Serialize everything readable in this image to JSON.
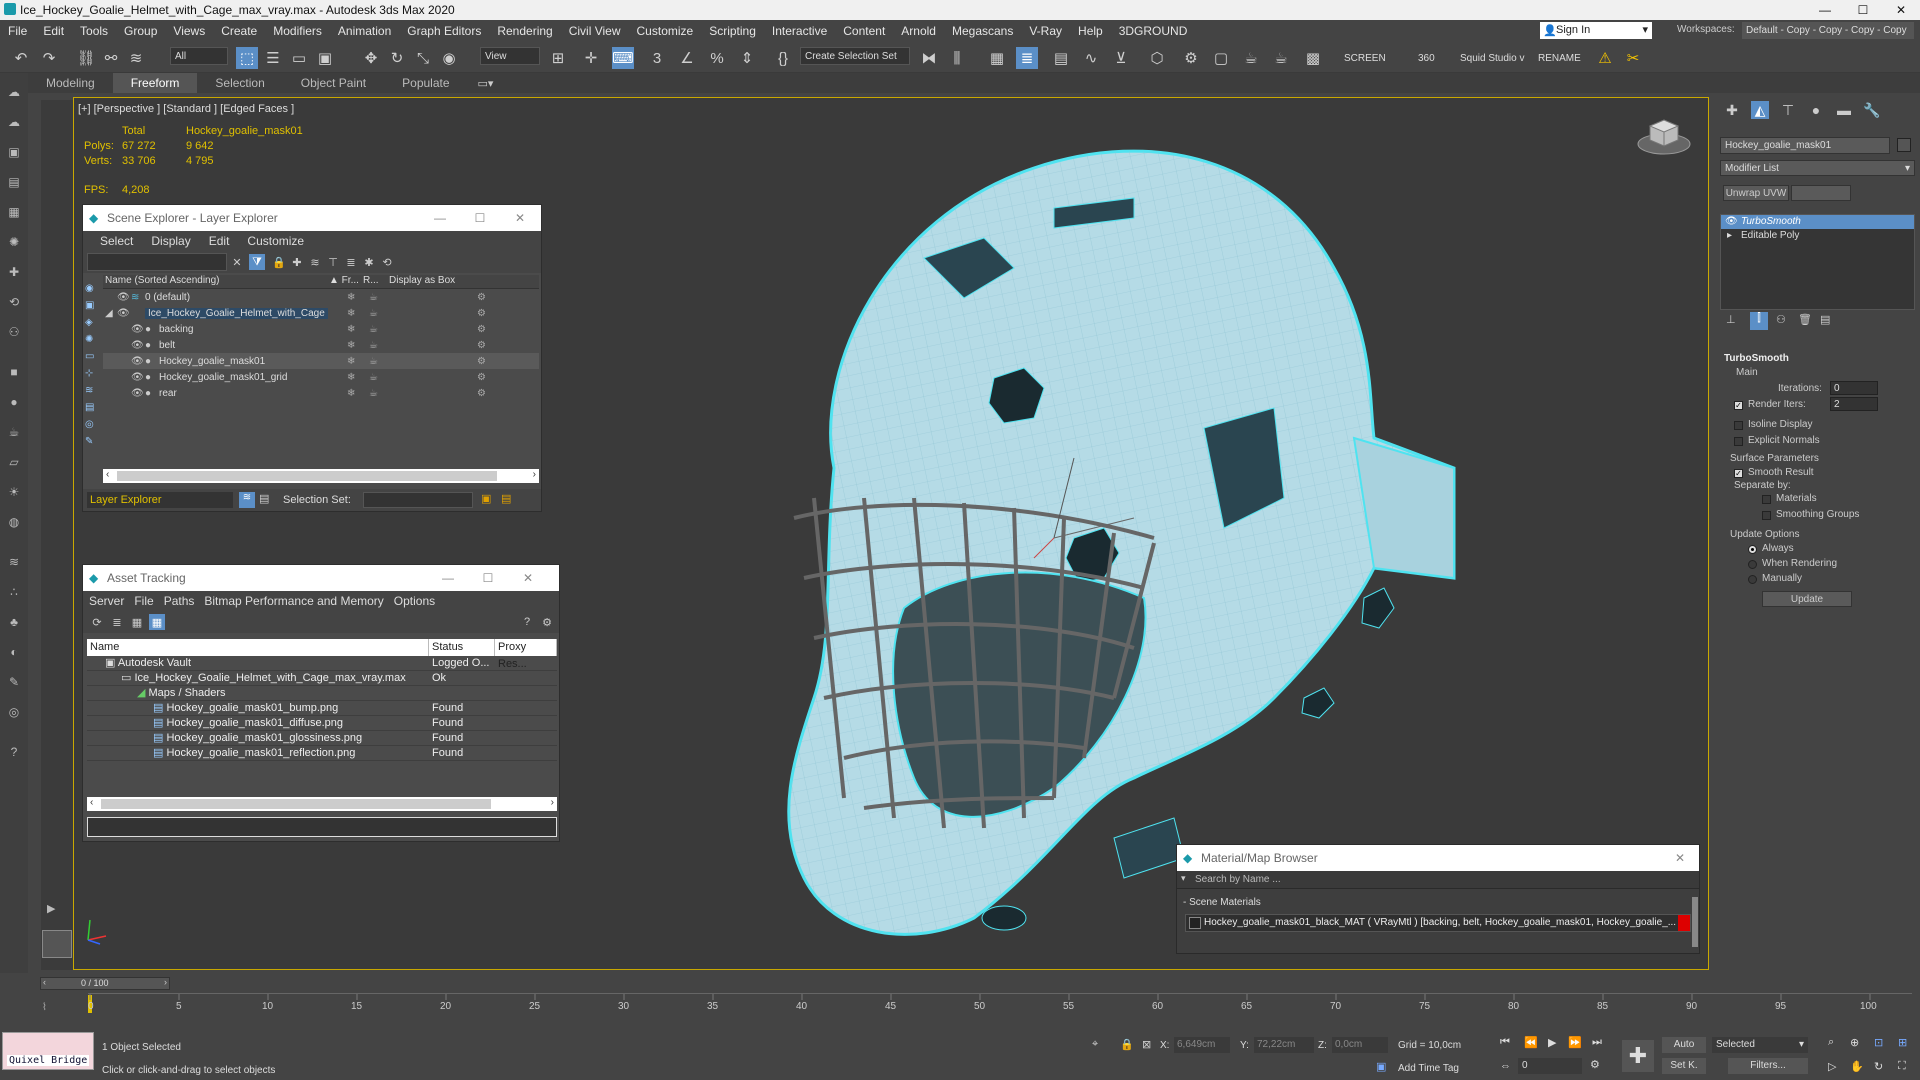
{
  "app": {
    "title": "Ice_Hockey_Goalie_Helmet_with_Cage_max_vray.max - Autodesk 3ds Max 2020",
    "window_buttons": [
      "—",
      "☐",
      "✕"
    ]
  },
  "menu": {
    "items": [
      "File",
      "Edit",
      "Tools",
      "Group",
      "Views",
      "Create",
      "Modifiers",
      "Animation",
      "Graph Editors",
      "Rendering",
      "Civil View",
      "Customize",
      "Scripting",
      "Interactive",
      "Content",
      "Arnold",
      "Megascans",
      "V-Ray",
      "Help",
      "3DGROUND"
    ],
    "sign_in": "Sign In",
    "workspaces_label": "Workspaces:",
    "workspace_value": "Default - Copy - Copy - Copy - Copy"
  },
  "toolbar": {
    "filter_value": "All",
    "refcoord_value": "View",
    "selection_set_value": "Create Selection Set",
    "screen_label": "SCREEN",
    "screen_value": "360",
    "squid_label": "Squid Studio v",
    "rename_label": "RENAME"
  },
  "ribbon": {
    "tabs": [
      "Modeling",
      "Freeform",
      "Selection",
      "Object Paint",
      "Populate"
    ],
    "active_tab": "Freeform"
  },
  "viewport": {
    "label": "[+] [Perspective ] [Standard ] [Edged Faces ]",
    "stats_header_total": "Total",
    "stats_header_object": "Hockey_goalie_mask01",
    "polys_label": "Polys:",
    "polys_total": "67 272",
    "polys_object": "9 642",
    "verts_label": "Verts:",
    "verts_total": "33 706",
    "verts_object": "4 795",
    "fps_label": "FPS:",
    "fps_value": "4,208"
  },
  "scene_explorer": {
    "title": "Scene Explorer - Layer Explorer",
    "menu": [
      "Select",
      "Display",
      "Edit",
      "Customize"
    ],
    "columns": [
      "Name (Sorted Ascending)",
      "▲ Fr...",
      "R...",
      "Display as Box"
    ],
    "rows": [
      {
        "name": "0 (default)",
        "level": 0
      },
      {
        "name": "Ice_Hockey_Goalie_Helmet_with_Cage",
        "level": 0
      },
      {
        "name": "backing",
        "level": 1
      },
      {
        "name": "belt",
        "level": 1
      },
      {
        "name": "Hockey_goalie_mask01",
        "level": 1
      },
      {
        "name": "Hockey_goalie_mask01_grid",
        "level": 1
      },
      {
        "name": "rear",
        "level": 1
      }
    ],
    "footer_layer": "Layer Explorer",
    "footer_selset_label": "Selection Set:"
  },
  "asset_tracking": {
    "title": "Asset Tracking",
    "menu": [
      "Server",
      "File",
      "Paths",
      "Bitmap Performance and Memory",
      "Options"
    ],
    "columns": [
      "Name",
      "Status",
      "Proxy Res..."
    ],
    "rows": [
      {
        "name": "Autodesk Vault",
        "status": "Logged O...",
        "indent": 1
      },
      {
        "name": "Ice_Hockey_Goalie_Helmet_with_Cage_max_vray.max",
        "status": "Ok",
        "indent": 2
      },
      {
        "name": "Maps / Shaders",
        "status": "",
        "indent": 3
      },
      {
        "name": "Hockey_goalie_mask01_bump.png",
        "status": "Found",
        "indent": 4
      },
      {
        "name": "Hockey_goalie_mask01_diffuse.png",
        "status": "Found",
        "indent": 4
      },
      {
        "name": "Hockey_goalie_mask01_glossiness.png",
        "status": "Found",
        "indent": 4
      },
      {
        "name": "Hockey_goalie_mask01_reflection.png",
        "status": "Found",
        "indent": 4
      }
    ]
  },
  "material_browser": {
    "title": "Material/Map Browser",
    "search_placeholder": "Search by Name ...",
    "section": "- Scene Materials",
    "material_entry": "Hockey_goalie_mask01_black_MAT  ( VRayMtl )  [backing, belt, Hockey_goalie_mask01, Hockey_goalie_..."
  },
  "command_panel": {
    "object_name": "Hockey_goalie_mask01",
    "modifier_list": "Modifier List",
    "unwrap_button": "Unwrap UVW",
    "stack": [
      "TurboSmooth",
      "Editable Poly"
    ],
    "rollout_title": "TurboSmooth",
    "main_label": "Main",
    "iterations_label": "Iterations:",
    "iterations_value": "0",
    "render_iters_label": "Render Iters:",
    "render_iters_value": "2",
    "render_iters_checked": true,
    "isoline_label": "Isoline Display",
    "explicit_label": "Explicit Normals",
    "surface_label": "Surface Parameters",
    "smooth_label": "Smooth Result",
    "separate_label": "Separate by:",
    "materials_label": "Materials",
    "smoothing_label": "Smoothing Groups",
    "update_options_label": "Update Options",
    "always_label": "Always",
    "when_rendering_label": "When Rendering",
    "manually_label": "Manually",
    "update_button": "Update"
  },
  "timeline": {
    "frame_display": "0 / 100",
    "ticks": [
      "0",
      "5",
      "10",
      "15",
      "20",
      "25",
      "30",
      "35",
      "40",
      "45",
      "50",
      "55",
      "60",
      "65",
      "70",
      "75",
      "80",
      "85",
      "90",
      "95",
      "100"
    ]
  },
  "status": {
    "quixel": "Quixel Bridge",
    "selection": "1 Object Selected",
    "prompt": "Click or click-and-drag to select objects",
    "x_label": "X:",
    "x_value": "6,649cm",
    "y_label": "Y:",
    "y_value": "72,22cm",
    "z_label": "Z:",
    "z_value": "0,0cm",
    "grid": "Grid = 10,0cm",
    "add_time_tag": "Add Time Tag",
    "auto_label": "Auto",
    "selected_value": "Selected",
    "setk_label": "Set K.",
    "filters_label": "Filters...",
    "frame_value": "0"
  },
  "colors": {
    "accent": "#5b8fc7",
    "viewport_border": "#c9a800",
    "helmet_fill": "#b5dbe6",
    "helmet_wire": "#4fe3f0",
    "stats_text": "#e0c000"
  }
}
